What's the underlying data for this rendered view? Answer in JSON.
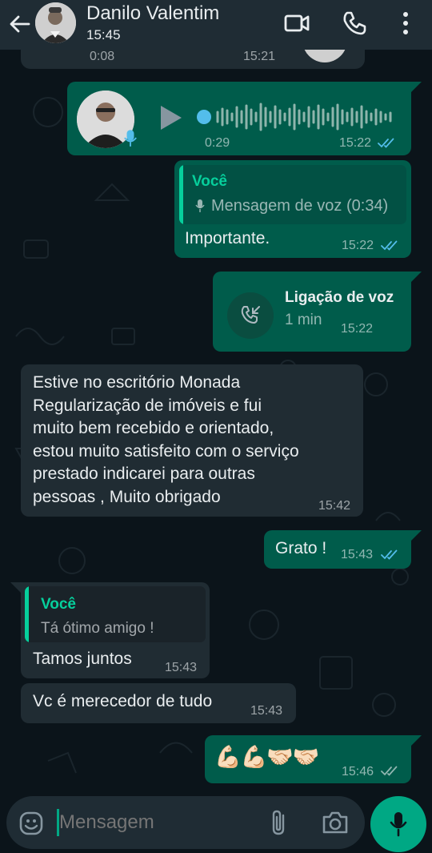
{
  "header": {
    "contact_name": "Danilo Valentim",
    "status": "15:45"
  },
  "partial_top": {
    "left": "0:08",
    "time": "15:21"
  },
  "voice_message": {
    "duration": "0:29",
    "time": "15:22"
  },
  "quoted_voice_reply": {
    "quote_author": "Você",
    "quote_text": "Mensagem de voz (0:34)",
    "text": "Importante.",
    "time": "15:22"
  },
  "voice_call": {
    "title": "Ligação de voz",
    "duration": "1 min",
    "time": "15:22"
  },
  "incoming_review": {
    "lines": [
      "Estive no escritório Monada",
      "Regularização de imóveis e fui",
      "muito bem recebido e orientado,",
      "estou muito satisfeito com o serviço",
      "prestado indicarei para outras",
      "pessoas , Muito obrigado"
    ],
    "time": "15:42"
  },
  "grato": {
    "text": "Grato !",
    "time": "15:43"
  },
  "incoming_reply": {
    "quote_author": "Você",
    "quote_text": "Tá ótimo amigo !",
    "text": "Tamos juntos",
    "time": "15:43"
  },
  "incoming_merecedor": {
    "text": "Vc é merecedor de tudo",
    "time": "15:43"
  },
  "emoji_message": {
    "emojis": "💪🏻💪🏻🤝🏻🤝🏻",
    "time": "15:46"
  },
  "input": {
    "placeholder": "Mensagem"
  },
  "colors": {
    "outgoing_bubble": "#005c4b",
    "incoming_bubble": "#202c33",
    "header": "#1f2c34",
    "accent": "#00a884",
    "read_ticks": "#53bdeb"
  }
}
